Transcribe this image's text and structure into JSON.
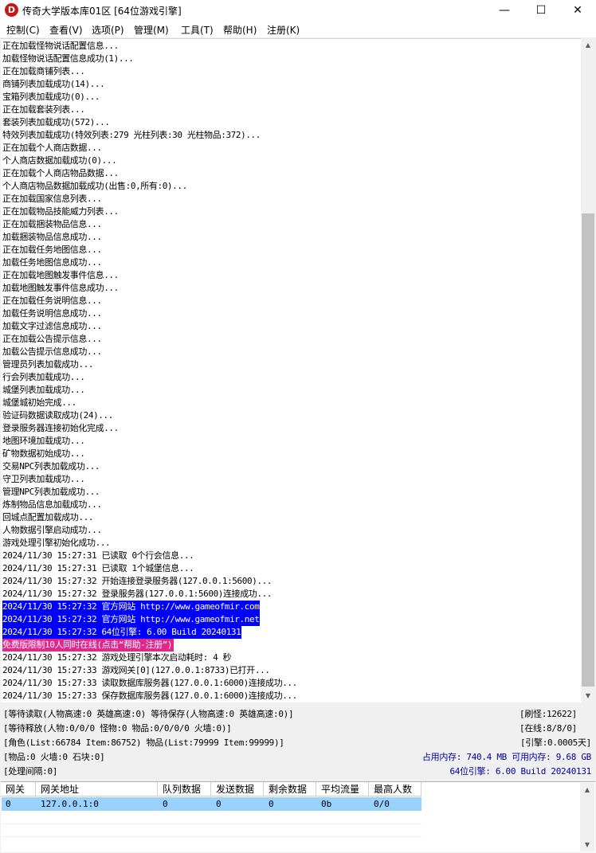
{
  "window": {
    "title": "传奇大学版本库01区 [64位游戏引擎]",
    "icon_letter": "D",
    "minimize_glyph": "—",
    "maximize_glyph": "☐",
    "close_glyph": "✕"
  },
  "menu": [
    "控制(C)",
    "查看(V)",
    "选项(P)",
    "管理(M)",
    "工具(T)",
    "帮助(H)",
    "注册(K)"
  ],
  "log_lines": [
    {
      "text": "正在加载怪物说话配置信息..."
    },
    {
      "text": "加载怪物说话配置信息成功(1)..."
    },
    {
      "text": "正在加载商铺列表..."
    },
    {
      "text": "商铺列表加载成功(14)..."
    },
    {
      "text": "宝箱列表加载成功(0)..."
    },
    {
      "text": "正在加载套装列表..."
    },
    {
      "text": "套装列表加载成功(572)..."
    },
    {
      "text": "特效列表加载成功(特效列表:279 光柱列表:30 光柱物品:372)..."
    },
    {
      "text": "正在加载个人商店数据..."
    },
    {
      "text": "个人商店数据加载成功(0)..."
    },
    {
      "text": "正在加载个人商店物品数据..."
    },
    {
      "text": "个人商店物品数据加载成功(出售:0,所有:0)..."
    },
    {
      "text": "正在加载国家信息列表..."
    },
    {
      "text": "正在加载物品技能威力列表..."
    },
    {
      "text": "正在加载捆装物品信息..."
    },
    {
      "text": "加载捆装物品信息成功..."
    },
    {
      "text": "正在加载任务地图信息..."
    },
    {
      "text": "加载任务地图信息成功..."
    },
    {
      "text": "正在加载地图触发事件信息..."
    },
    {
      "text": "加载地图触发事件信息成功..."
    },
    {
      "text": "正在加载任务说明信息..."
    },
    {
      "text": "加载任务说明信息成功..."
    },
    {
      "text": "加载文字过滤信息成功..."
    },
    {
      "text": "正在加载公告提示信息..."
    },
    {
      "text": "加载公告提示信息成功..."
    },
    {
      "text": "管理员列表加载成功..."
    },
    {
      "text": "行会列表加载成功..."
    },
    {
      "text": "城堡列表加载成功..."
    },
    {
      "text": "城堡城初始完成..."
    },
    {
      "text": "验证码数据读取成功(24)..."
    },
    {
      "text": "登录服务器连接初始化完成..."
    },
    {
      "text": "地图环境加载成功..."
    },
    {
      "text": "矿物数据初始成功..."
    },
    {
      "text": "交易NPC列表加载成功..."
    },
    {
      "text": "守卫列表加载成功..."
    },
    {
      "text": "管理NPC列表加载成功..."
    },
    {
      "text": "炼制物品信息加载成功..."
    },
    {
      "text": "回城点配置加载成功..."
    },
    {
      "text": "人物数据引擎启动成功..."
    },
    {
      "text": "游戏处理引擎初始化成功..."
    },
    {
      "text": "2024/11/30 15:27:31 已读取 0个行会信息..."
    },
    {
      "text": "2024/11/30 15:27:31 已读取 1个城堡信息..."
    },
    {
      "text": "2024/11/30 15:27:32 开始连接登录服务器(127.0.0.1:5600)..."
    },
    {
      "text": "2024/11/30 15:27:32 登录服务器(127.0.0.1:5600)连接成功..."
    },
    {
      "text": "2024/11/30 15:27:32 官方网站 http://www.gameofmir.com",
      "style": "hl-blue"
    },
    {
      "text": "2024/11/30 15:27:32 官方网站 http://www.gameofmir.net",
      "style": "hl-blue"
    },
    {
      "text": "2024/11/30 15:27:32 64位引擎: 6.00 Build 20240131",
      "style": "hl-blue"
    },
    {
      "text": "免费版限制10人同时在线(点击“帮助-注册”)",
      "style": "hl-pink"
    },
    {
      "text": "2024/11/30 15:27:32 游戏处理引擎本次启动耗时: 4 秒"
    },
    {
      "text": "2024/11/30 15:27:33 游戏网关[0](127.0.0.1:8733)已打开..."
    },
    {
      "text": "2024/11/30 15:27:33 读取数据库服务器(127.0.0.1:6000)连接成功..."
    },
    {
      "text": "2024/11/30 15:27:33 保存数据库服务器(127.0.0.1:6000)连接成功..."
    }
  ],
  "status": {
    "line1": "[等待读取(人物高速:0 英雄高速:0) 等待保存(人物高速:0 英雄高速:0)]",
    "line2": "[等待释放(人物:0/0/0 怪物:0 物品:0/0/0/0 火墙:0)]",
    "line3": "[角色(List:66784 Item:86752) 物品(List:79999 Item:99999)]",
    "line4": "[物品:0 火墙:0 石块:0]",
    "line5": "[处理间隔:0]",
    "refresh_monster": "[刷怪:12622]",
    "online": "[在线:8/8/0]",
    "engine": "[引擎:0.0005天]",
    "memory": "占用内存: 740.4 MB 可用内存: 9.68 GB",
    "engine_version": "64位引擎: 6.00 Build 20240131"
  },
  "gateway_table": {
    "headers": [
      "网关",
      "网关地址",
      "队列数据",
      "发送数据",
      "剩余数据",
      "平均流量",
      "最高人数"
    ],
    "rows": [
      [
        "0",
        "127.0.0.1:0",
        "0",
        "0",
        "0",
        "0b",
        "0/0"
      ]
    ]
  },
  "colors": {
    "highlight_blue": "#0000ff",
    "highlight_pink": "#e0288c",
    "selected_row": "#99d1ff",
    "status_blue_text": "#0000a0",
    "app_icon_red": "#c51818"
  }
}
